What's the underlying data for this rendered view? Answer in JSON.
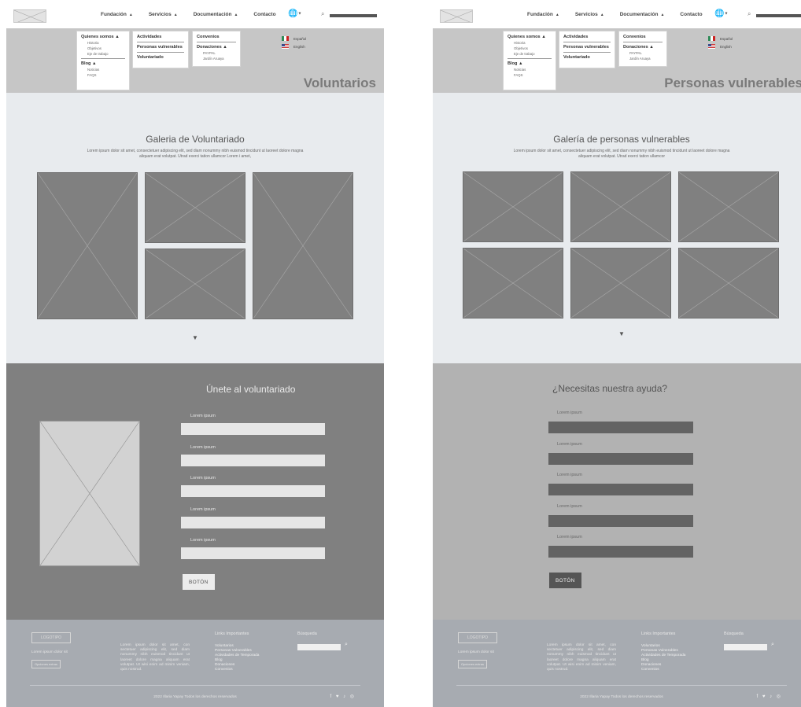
{
  "nav": {
    "items": [
      "Fundación",
      "Servicios",
      "Documentación",
      "Contacto"
    ],
    "item_carets": [
      true,
      true,
      true,
      false
    ],
    "caret": "▲",
    "globe_icon": "globe-icon",
    "search_icon": "search-icon"
  },
  "menus": {
    "quienes": {
      "label": "Quienes somos",
      "children": [
        "Historia",
        "Objetivos",
        "Eje de trabajo"
      ]
    },
    "blog": {
      "label": "Blog",
      "children": [
        "Noticias",
        "FAQS"
      ]
    },
    "servicios": [
      "Actividades",
      "Personas vulnerables",
      "Voluntariado"
    ],
    "convenios": "Convenios",
    "donaciones": {
      "label": "Donaciones",
      "children": [
        "PAYPAL",
        "Jardín Aruaya"
      ]
    }
  },
  "languages": [
    "Español",
    "English"
  ],
  "pages": [
    {
      "hero_title": "Voluntarios",
      "gallery_title": "Galeria de Voluntariado",
      "gallery_text": "Lorem ipsum dolor sit amet, consectetuer adipiscing elit, sed diam nonummy nibh euismod tincidunt ut laoreet dolore magna aliquam erat volutpat. Utrad exerci tation ullamcor Lorem i amet,",
      "form_title": "Únete al voluntariado",
      "field_labels": [
        "Lorem ipsum",
        "Lorem ipsum",
        "Lorem ipsum",
        "Lorem ipsum",
        "Lorem ipsum"
      ],
      "button": "BOTÓN"
    },
    {
      "hero_title": "Personas vulnerables",
      "gallery_title": "Galería de personas vulnerables",
      "gallery_text": "Lorem ipsum dolor sit amet, consectetuer adipiscing elit, sed diam nonummy nibh euismod tincidunt ut laoreet dolore magna aliquam erat volutpat. Utrad exerci tation ullamcor",
      "form_title": "¿Necesitas nuestra ayuda?",
      "field_labels": [
        "Lorem ipsum",
        "Lorem ipsum",
        "Lorem ipsum",
        "Lorem ipsum",
        "Lorem ipsum"
      ],
      "button": "BOTÓN"
    }
  ],
  "footer": {
    "logo": "LOGOTIPO",
    "tagline": "Lorem ipsum dolor sit",
    "small_button": "Opciones extras",
    "paragraph": "Lorem ipsum dolor sit amet, con sectetuer adipiscing elit, sed diam nonummy nibh euismod tincidunt ut laoreet dolore magna aliquam erat volutpat. Ut wisi enim ad minim veniam, quis nostrud.",
    "links_title": "Links Importantes",
    "links": [
      "Voluntarios",
      "Personas Vulnerables",
      "Actividades de Temporada",
      "Blog",
      "Donaciones",
      "Convenios"
    ],
    "search_title": "Búsqueda",
    "copyright": "2022 Illaria Yapay Todos los derechos reservados",
    "social_icons": [
      "facebook-icon",
      "twitter-icon",
      "tiktok-icon",
      "instagram-icon"
    ],
    "social_glyphs": "f  ♥ ♪ ◎"
  },
  "colors": {
    "hero_bg": "#c6c6c6",
    "gallery_bg": "#e8ebee",
    "form_bg_dark": "#808080",
    "form_bg_light": "#b2b2b2",
    "footer_bg": "#a7abb1",
    "placeholder": "#808080"
  }
}
